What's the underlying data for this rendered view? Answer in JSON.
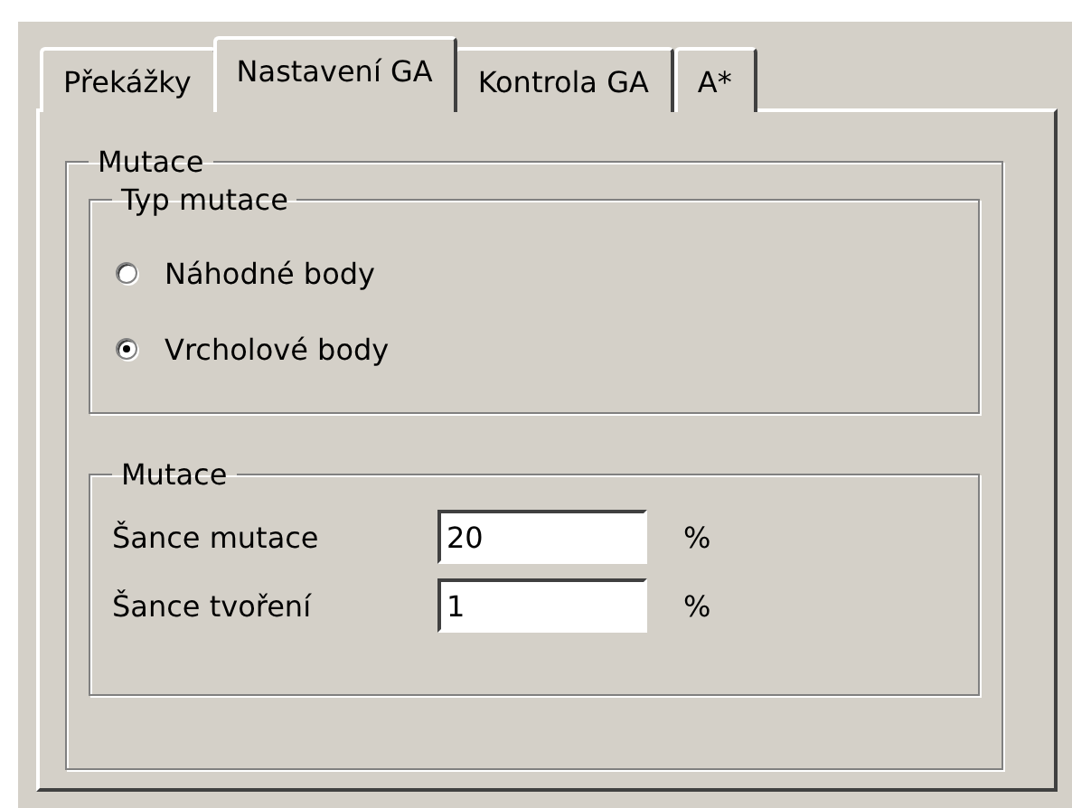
{
  "tabs": [
    {
      "label": "Překážky",
      "selected": false
    },
    {
      "label": "Nastavení GA",
      "selected": true
    },
    {
      "label": "Kontrola GA",
      "selected": false
    },
    {
      "label": "A*",
      "selected": false
    }
  ],
  "group": {
    "title": "Mutace",
    "mutation_type": {
      "title": "Typ mutace",
      "options": [
        {
          "label": "Náhodné body",
          "selected": false
        },
        {
          "label": "Vrcholové body",
          "selected": true
        }
      ]
    },
    "mutation": {
      "title": "Mutace",
      "fields": [
        {
          "label": "Šance mutace",
          "value": "20",
          "unit": "%"
        },
        {
          "label": "Šance tvoření",
          "value": "1",
          "unit": "%"
        }
      ]
    }
  }
}
